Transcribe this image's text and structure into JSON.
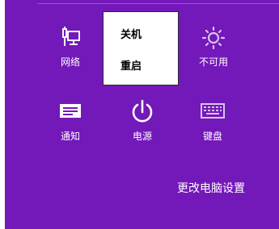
{
  "quick_settings": {
    "network": {
      "label": "网络",
      "icon": "network-icon"
    },
    "brightness": {
      "label": "不可用",
      "icon": "brightness-icon"
    },
    "notifications": {
      "label": "通知",
      "icon": "notifications-icon"
    },
    "power": {
      "label": "电源",
      "icon": "power-icon"
    },
    "keyboard": {
      "label": "键盘",
      "icon": "keyboard-icon"
    }
  },
  "power_menu": {
    "items": [
      {
        "label": "关机"
      },
      {
        "label": "重启"
      }
    ]
  },
  "footer": {
    "pc_settings_label": "更改电脑设置"
  },
  "colors": {
    "charm_background": "#7318b9",
    "text": "#ffffff",
    "menu_background": "#ffffff"
  }
}
